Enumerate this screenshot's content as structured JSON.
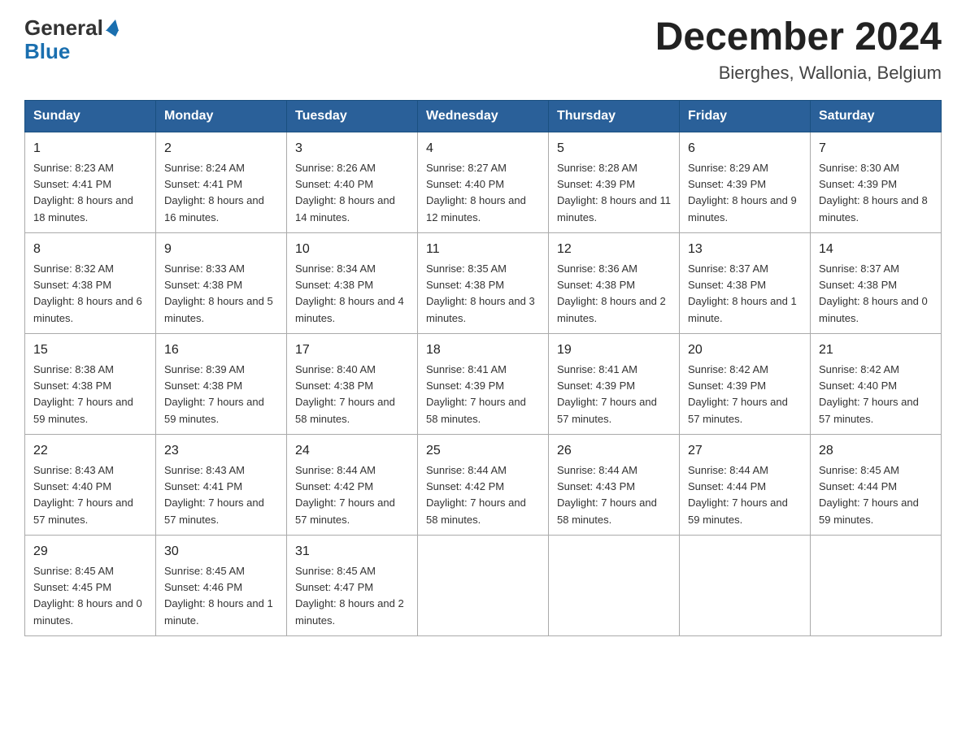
{
  "header": {
    "logo": {
      "general": "General",
      "blue": "Blue"
    },
    "title": "December 2024",
    "subtitle": "Bierghes, Wallonia, Belgium"
  },
  "days_of_week": [
    "Sunday",
    "Monday",
    "Tuesday",
    "Wednesday",
    "Thursday",
    "Friday",
    "Saturday"
  ],
  "weeks": [
    [
      {
        "day": "1",
        "sunrise": "8:23 AM",
        "sunset": "4:41 PM",
        "daylight": "8 hours and 18 minutes."
      },
      {
        "day": "2",
        "sunrise": "8:24 AM",
        "sunset": "4:41 PM",
        "daylight": "8 hours and 16 minutes."
      },
      {
        "day": "3",
        "sunrise": "8:26 AM",
        "sunset": "4:40 PM",
        "daylight": "8 hours and 14 minutes."
      },
      {
        "day": "4",
        "sunrise": "8:27 AM",
        "sunset": "4:40 PM",
        "daylight": "8 hours and 12 minutes."
      },
      {
        "day": "5",
        "sunrise": "8:28 AM",
        "sunset": "4:39 PM",
        "daylight": "8 hours and 11 minutes."
      },
      {
        "day": "6",
        "sunrise": "8:29 AM",
        "sunset": "4:39 PM",
        "daylight": "8 hours and 9 minutes."
      },
      {
        "day": "7",
        "sunrise": "8:30 AM",
        "sunset": "4:39 PM",
        "daylight": "8 hours and 8 minutes."
      }
    ],
    [
      {
        "day": "8",
        "sunrise": "8:32 AM",
        "sunset": "4:38 PM",
        "daylight": "8 hours and 6 minutes."
      },
      {
        "day": "9",
        "sunrise": "8:33 AM",
        "sunset": "4:38 PM",
        "daylight": "8 hours and 5 minutes."
      },
      {
        "day": "10",
        "sunrise": "8:34 AM",
        "sunset": "4:38 PM",
        "daylight": "8 hours and 4 minutes."
      },
      {
        "day": "11",
        "sunrise": "8:35 AM",
        "sunset": "4:38 PM",
        "daylight": "8 hours and 3 minutes."
      },
      {
        "day": "12",
        "sunrise": "8:36 AM",
        "sunset": "4:38 PM",
        "daylight": "8 hours and 2 minutes."
      },
      {
        "day": "13",
        "sunrise": "8:37 AM",
        "sunset": "4:38 PM",
        "daylight": "8 hours and 1 minute."
      },
      {
        "day": "14",
        "sunrise": "8:37 AM",
        "sunset": "4:38 PM",
        "daylight": "8 hours and 0 minutes."
      }
    ],
    [
      {
        "day": "15",
        "sunrise": "8:38 AM",
        "sunset": "4:38 PM",
        "daylight": "7 hours and 59 minutes."
      },
      {
        "day": "16",
        "sunrise": "8:39 AM",
        "sunset": "4:38 PM",
        "daylight": "7 hours and 59 minutes."
      },
      {
        "day": "17",
        "sunrise": "8:40 AM",
        "sunset": "4:38 PM",
        "daylight": "7 hours and 58 minutes."
      },
      {
        "day": "18",
        "sunrise": "8:41 AM",
        "sunset": "4:39 PM",
        "daylight": "7 hours and 58 minutes."
      },
      {
        "day": "19",
        "sunrise": "8:41 AM",
        "sunset": "4:39 PM",
        "daylight": "7 hours and 57 minutes."
      },
      {
        "day": "20",
        "sunrise": "8:42 AM",
        "sunset": "4:39 PM",
        "daylight": "7 hours and 57 minutes."
      },
      {
        "day": "21",
        "sunrise": "8:42 AM",
        "sunset": "4:40 PM",
        "daylight": "7 hours and 57 minutes."
      }
    ],
    [
      {
        "day": "22",
        "sunrise": "8:43 AM",
        "sunset": "4:40 PM",
        "daylight": "7 hours and 57 minutes."
      },
      {
        "day": "23",
        "sunrise": "8:43 AM",
        "sunset": "4:41 PM",
        "daylight": "7 hours and 57 minutes."
      },
      {
        "day": "24",
        "sunrise": "8:44 AM",
        "sunset": "4:42 PM",
        "daylight": "7 hours and 57 minutes."
      },
      {
        "day": "25",
        "sunrise": "8:44 AM",
        "sunset": "4:42 PM",
        "daylight": "7 hours and 58 minutes."
      },
      {
        "day": "26",
        "sunrise": "8:44 AM",
        "sunset": "4:43 PM",
        "daylight": "7 hours and 58 minutes."
      },
      {
        "day": "27",
        "sunrise": "8:44 AM",
        "sunset": "4:44 PM",
        "daylight": "7 hours and 59 minutes."
      },
      {
        "day": "28",
        "sunrise": "8:45 AM",
        "sunset": "4:44 PM",
        "daylight": "7 hours and 59 minutes."
      }
    ],
    [
      {
        "day": "29",
        "sunrise": "8:45 AM",
        "sunset": "4:45 PM",
        "daylight": "8 hours and 0 minutes."
      },
      {
        "day": "30",
        "sunrise": "8:45 AM",
        "sunset": "4:46 PM",
        "daylight": "8 hours and 1 minute."
      },
      {
        "day": "31",
        "sunrise": "8:45 AM",
        "sunset": "4:47 PM",
        "daylight": "8 hours and 2 minutes."
      },
      null,
      null,
      null,
      null
    ]
  ],
  "labels": {
    "sunrise": "Sunrise: ",
    "sunset": "Sunset: ",
    "daylight": "Daylight: "
  }
}
